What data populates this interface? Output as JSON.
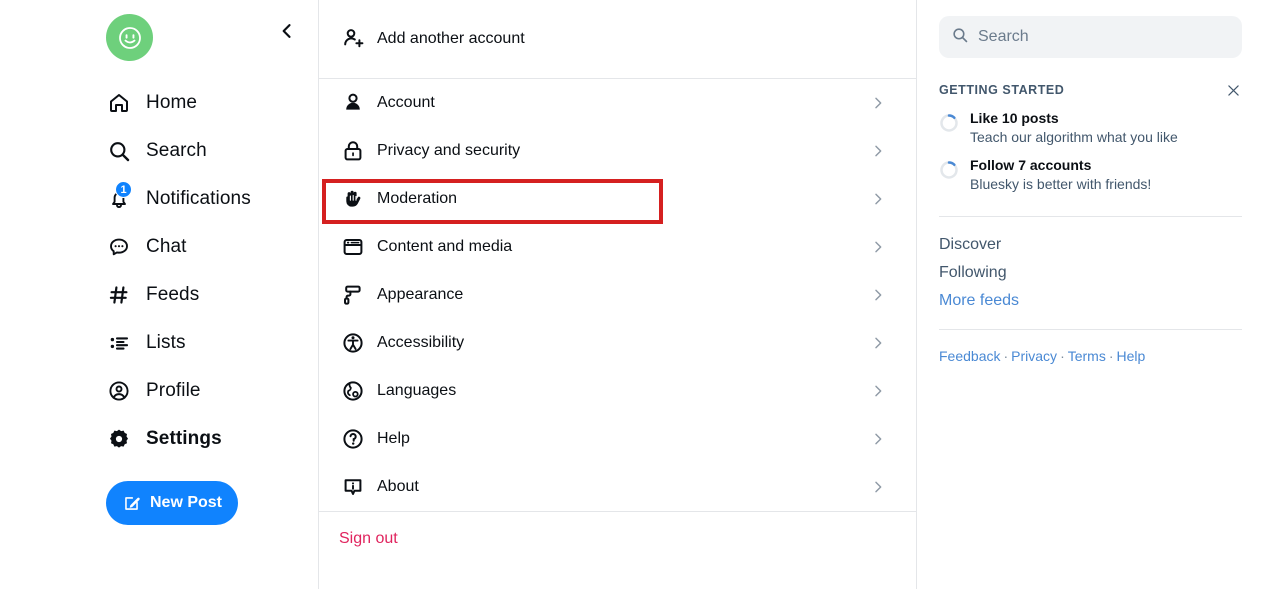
{
  "left_nav": {
    "avatar_label": "profile-avatar",
    "avatar_color": "#6ed07c",
    "collapse_label": "Collapse sidebar",
    "items": [
      {
        "label": "Home",
        "icon": "home-icon",
        "active": false,
        "badge": ""
      },
      {
        "label": "Search",
        "icon": "search-icon",
        "active": false,
        "badge": ""
      },
      {
        "label": "Notifications",
        "icon": "bell-icon",
        "active": false,
        "badge": "1"
      },
      {
        "label": "Chat",
        "icon": "chat-bubble-icon",
        "active": false,
        "badge": ""
      },
      {
        "label": "Feeds",
        "icon": "hashtag-icon",
        "active": false,
        "badge": ""
      },
      {
        "label": "Lists",
        "icon": "list-icon",
        "active": false,
        "badge": ""
      },
      {
        "label": "Profile",
        "icon": "user-circle-icon",
        "active": false,
        "badge": ""
      },
      {
        "label": "Settings",
        "icon": "gear-icon",
        "active": true,
        "badge": ""
      }
    ],
    "new_post_label": "New Post",
    "new_post_icon": "compose-icon",
    "new_post_color": "#1083fe",
    "badge_color": "#1083fe"
  },
  "settings": {
    "add_account": {
      "label": "Add another account",
      "icon": "user-plus-icon"
    },
    "items": [
      {
        "label": "Account",
        "icon": "user-icon"
      },
      {
        "label": "Privacy and security",
        "icon": "lock-icon"
      },
      {
        "label": "Moderation",
        "icon": "hand-raised-icon"
      },
      {
        "label": "Content and media",
        "icon": "media-window-icon"
      },
      {
        "label": "Appearance",
        "icon": "paint-roller-icon"
      },
      {
        "label": "Accessibility",
        "icon": "accessibility-icon"
      },
      {
        "label": "Languages",
        "icon": "globe-icon"
      },
      {
        "label": "Help",
        "icon": "question-circle-icon"
      },
      {
        "label": "About",
        "icon": "info-square-icon"
      }
    ],
    "sign_out_label": "Sign out",
    "sign_out_color": "#e0245e",
    "highlight": {
      "target_label": "Moderation",
      "color": "#d52020"
    }
  },
  "right_panel": {
    "search": {
      "placeholder": "Search",
      "value": "",
      "icon": "search-icon"
    },
    "getting_started": {
      "title": "GETTING STARTED",
      "close_icon": "close-icon",
      "tasks": [
        {
          "title": "Like 10 posts",
          "subtitle": "Teach our algorithm what you like"
        },
        {
          "title": "Follow 7 accounts",
          "subtitle": "Bluesky is better with friends!"
        }
      ]
    },
    "feeds": [
      {
        "label": "Discover",
        "highlight": false
      },
      {
        "label": "Following",
        "highlight": false
      },
      {
        "label": "More feeds",
        "highlight": true
      }
    ],
    "footer": {
      "links": [
        "Feedback",
        "Privacy",
        "Terms",
        "Help"
      ],
      "separator": "·",
      "link_color": "#4a89d4"
    }
  }
}
